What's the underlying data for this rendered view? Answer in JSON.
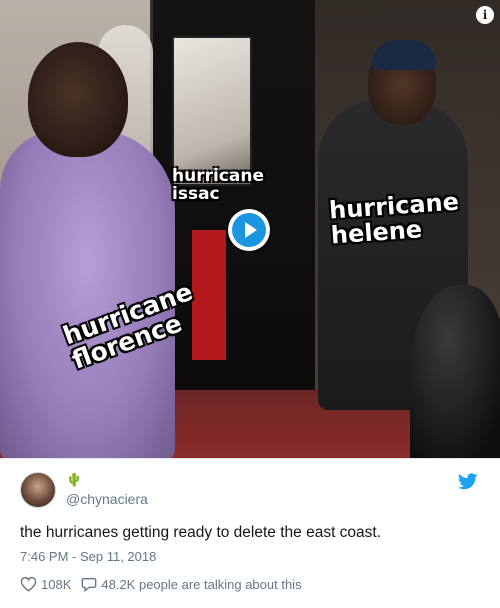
{
  "media": {
    "labels": {
      "issac": "hurricane\nissac",
      "helene": "hurricane\nhelene",
      "florence": "hurricane\nflorence"
    },
    "play_icon": "play-icon",
    "info_glyph": "i"
  },
  "tweet": {
    "emoji": "🌵",
    "handle": "@chynaciera",
    "text": "the hurricanes getting ready to delete the east coast.",
    "timestamp": "7:46 PM - Sep 11, 2018",
    "likes": "108K",
    "talking": "48.2K people are talking about this"
  },
  "colors": {
    "accent": "#1b95e0",
    "muted": "#657786",
    "text": "#14171a"
  }
}
